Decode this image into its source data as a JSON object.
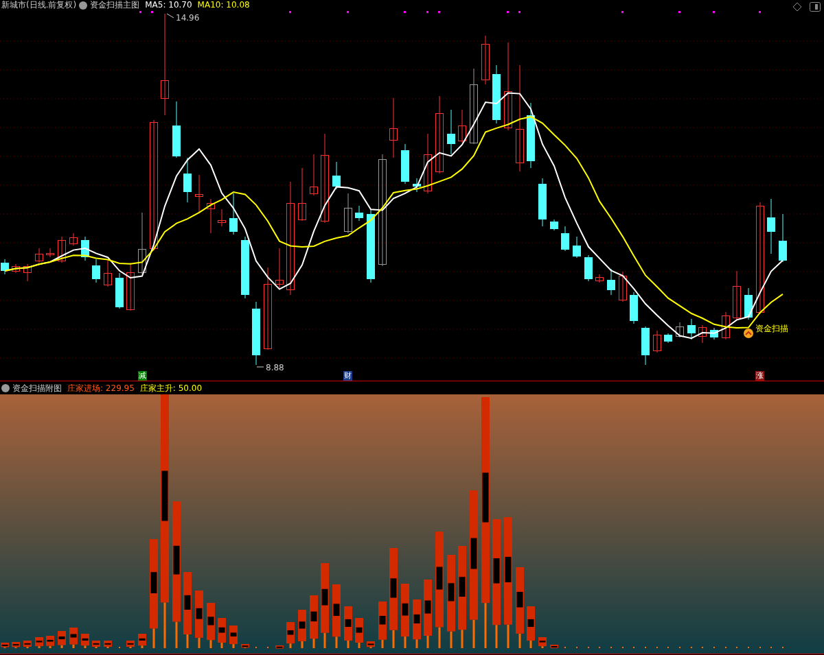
{
  "main_chart": {
    "security": "新城市(日线.前复权)",
    "indicator": "资金扫描主图",
    "legend": [
      {
        "label": "MA5: 10.70",
        "color": "#ffffff"
      },
      {
        "label": "MA10: 10.08",
        "color": "#ffff00"
      }
    ],
    "high_label": "14.96",
    "low_label": "8.88",
    "signal_label": "资金扫描",
    "tags": [
      {
        "text": "减",
        "color": "#008000"
      },
      {
        "text": "财",
        "color": "#1a3a8a"
      },
      {
        "text": "涨",
        "color": "#8b1010"
      }
    ]
  },
  "sub_chart": {
    "indicator": "资金扫描附图",
    "legend": [
      {
        "label": "庄家进场: 229.95",
        "color": "#ff5a1a"
      },
      {
        "label": "庄家主升: 50.00",
        "color": "#ffff00"
      }
    ]
  }
}
